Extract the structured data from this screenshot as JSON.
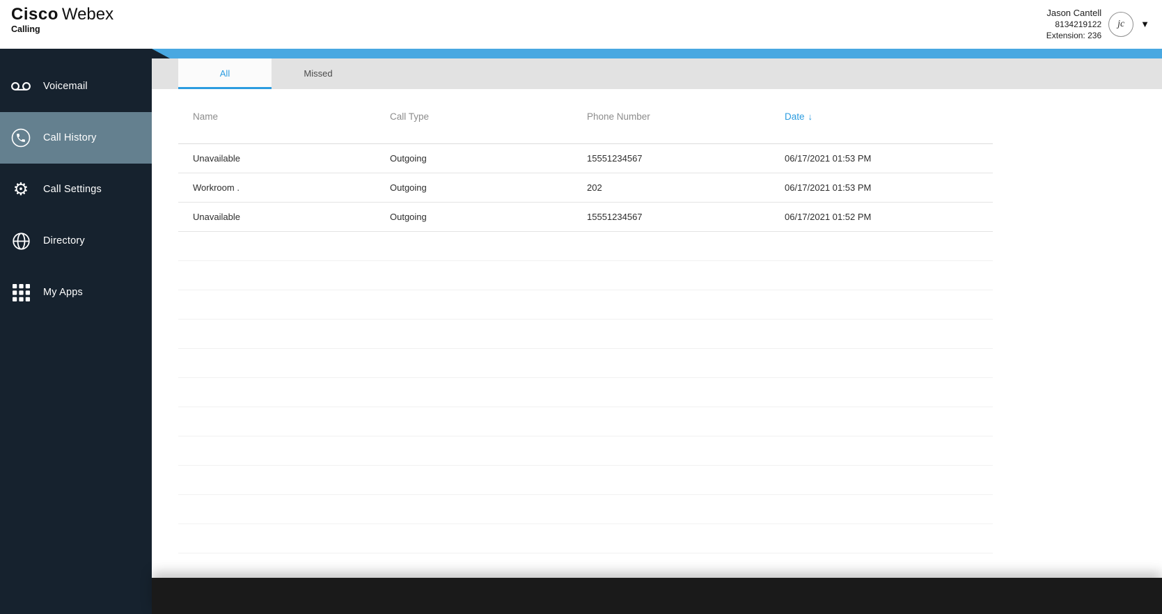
{
  "header": {
    "brand": {
      "cisco": "Cisco",
      "webex": "Webex",
      "product": "Calling"
    },
    "user": {
      "name": "Jason Cantell",
      "phone": "8134219122",
      "extension": "Extension: 236",
      "avatar_initials": "jc"
    }
  },
  "sidebar": {
    "items": [
      {
        "label": "Voicemail",
        "icon": "voicemail-icon",
        "active": false
      },
      {
        "label": "Call History",
        "icon": "phone-icon",
        "active": true
      },
      {
        "label": "Call Settings",
        "icon": "gear-icon",
        "active": false
      },
      {
        "label": "Directory",
        "icon": "globe-icon",
        "active": false
      },
      {
        "label": "My Apps",
        "icon": "grid-icon",
        "active": false
      }
    ]
  },
  "main": {
    "tabs": [
      {
        "label": "All",
        "active": true
      },
      {
        "label": "Missed",
        "active": false
      }
    ],
    "table": {
      "columns": [
        "Name",
        "Call Type",
        "Phone Number",
        "Date"
      ],
      "sort": {
        "column": "Date",
        "direction": "desc"
      },
      "sort_arrow": "↓",
      "rows": [
        {
          "name": "Unavailable",
          "call_type": "Outgoing",
          "phone": "15551234567",
          "date": "06/17/2021 01:53 PM"
        },
        {
          "name": "Workroom .",
          "call_type": "Outgoing",
          "phone": "202",
          "date": "06/17/2021 01:53 PM"
        },
        {
          "name": "Unavailable",
          "call_type": "Outgoing",
          "phone": "15551234567",
          "date": "06/17/2021 01:52 PM"
        }
      ]
    }
  },
  "colors": {
    "accent": "#49A8E1",
    "link_blue": "#2B9CE0",
    "sidebar_bg": "#16222E",
    "active_item_bg": "#64808F",
    "tabbar_bg": "#E2E2E2",
    "footer_bg": "#1A1A1A"
  }
}
